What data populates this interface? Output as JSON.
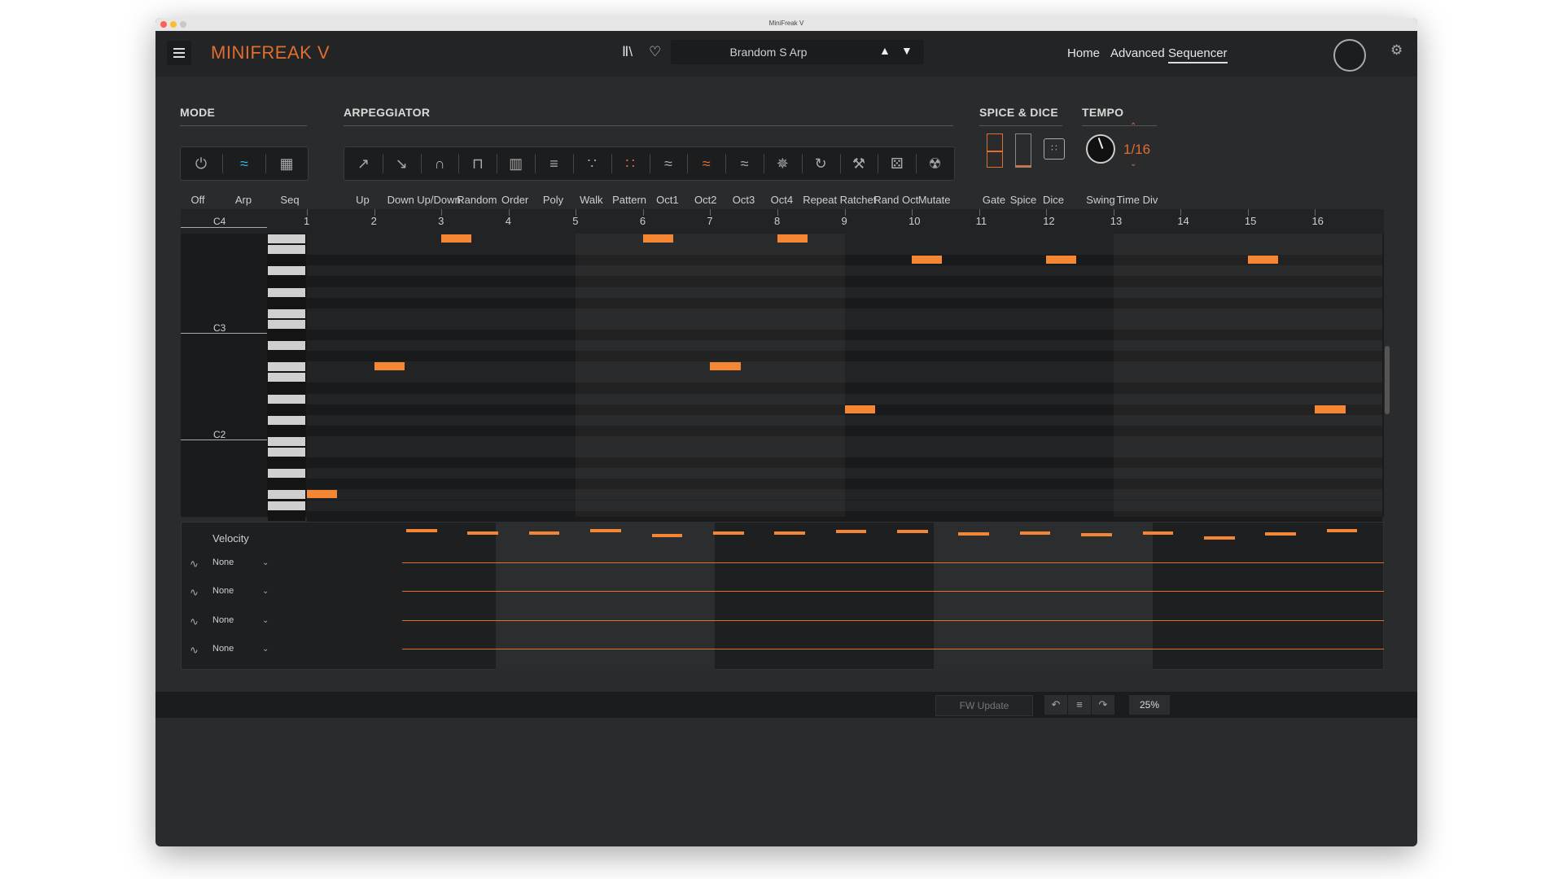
{
  "window": {
    "title": "MiniFreak V"
  },
  "topbar": {
    "app_name": "MINIFREAK V",
    "preset_name": "Brandom S Arp",
    "nav": [
      "Home",
      "Advanced",
      "Sequencer"
    ],
    "active_nav": "Sequencer"
  },
  "mode": {
    "title": "MODE",
    "options": [
      "Off",
      "Arp",
      "Seq"
    ],
    "selected": "Arp"
  },
  "arpeggiator": {
    "title": "ARPEGGIATOR",
    "options": [
      "Up",
      "Down",
      "Up/Down",
      "Random",
      "Order",
      "Poly",
      "Walk",
      "Pattern",
      "Oct1",
      "Oct2",
      "Oct3",
      "Oct4",
      "Repeat",
      "Ratchet",
      "Rand Oct",
      "Mutate"
    ],
    "highlighted": [
      "Pattern",
      "Oct2"
    ]
  },
  "spice_dice": {
    "title": "SPICE & DICE",
    "labels": [
      "Gate",
      "Spice",
      "Dice"
    ]
  },
  "tempo": {
    "title": "TEMPO",
    "time_div": "1/16",
    "labels": [
      "Swing",
      "Time Div"
    ]
  },
  "sequencer": {
    "steps": [
      "1",
      "2",
      "3",
      "4",
      "5",
      "6",
      "7",
      "8",
      "9",
      "10",
      "11",
      "12",
      "13",
      "14",
      "15",
      "16"
    ],
    "note_labels": [
      "C4",
      "C3",
      "C2"
    ],
    "notes": [
      {
        "step": 1,
        "pitch": "C2"
      },
      {
        "step": 2,
        "pitch": "C3"
      },
      {
        "step": 3,
        "pitch": "C4"
      },
      {
        "step": 6,
        "pitch": "C4"
      },
      {
        "step": 7,
        "pitch": "C3"
      },
      {
        "step": 8,
        "pitch": "C4"
      },
      {
        "step": 9,
        "pitch": "G#2"
      },
      {
        "step": 10,
        "pitch": "A#3"
      },
      {
        "step": 12,
        "pitch": "A#3"
      },
      {
        "step": 15,
        "pitch": "A#3"
      },
      {
        "step": 16,
        "pitch": "G#2"
      }
    ]
  },
  "velocity": {
    "title": "Velocity",
    "values": [
      0.96,
      0.93,
      0.93,
      0.96,
      0.89,
      0.93,
      0.93,
      0.95,
      0.95,
      0.91,
      0.93,
      0.9,
      0.92,
      0.85,
      0.91,
      0.96
    ]
  },
  "mod_lanes": [
    {
      "label": "None"
    },
    {
      "label": "None"
    },
    {
      "label": "None"
    },
    {
      "label": "None"
    }
  ],
  "statusbar": {
    "fw_update": "FW Update",
    "zoom": "25%"
  },
  "colors": {
    "accent": "#f58634",
    "brand": "#e16d2f",
    "arp_active": "#35b4e0"
  }
}
